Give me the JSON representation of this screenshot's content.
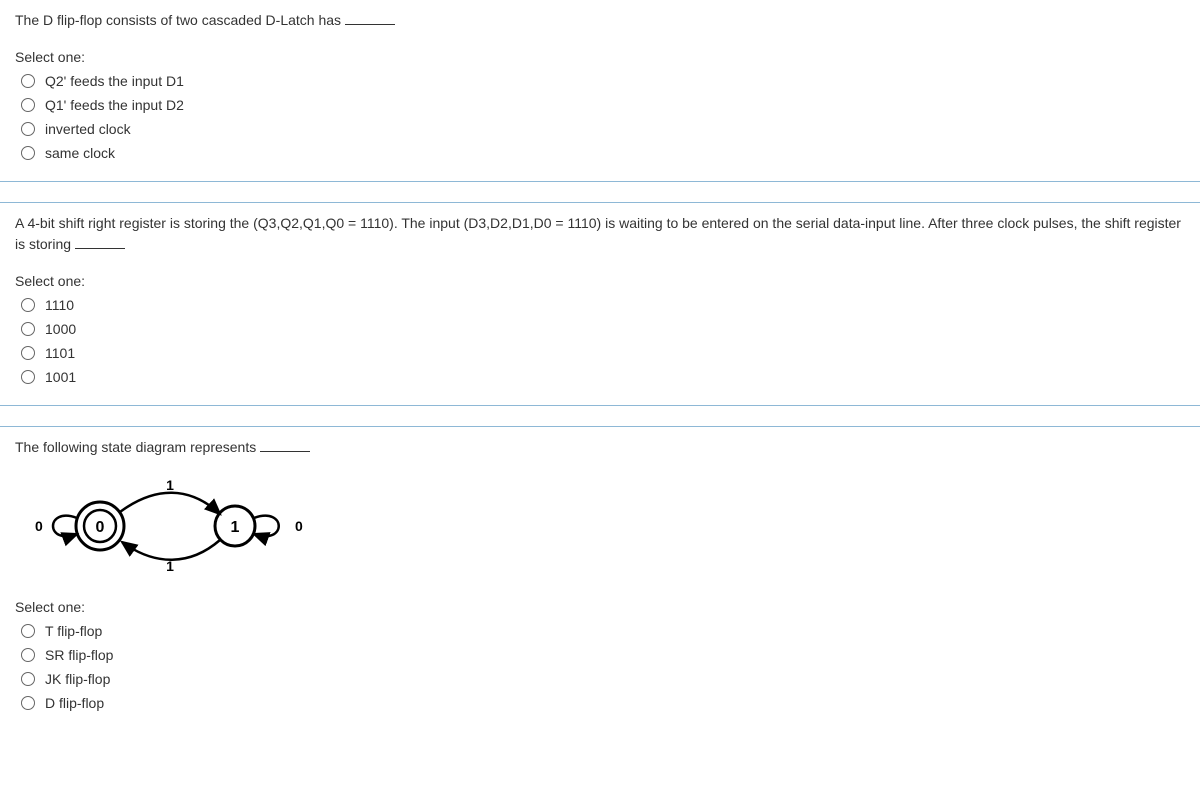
{
  "question1": {
    "text": "The D flip-flop consists of two cascaded D-Latch has",
    "select_label": "Select one:",
    "options": [
      "Q2' feeds the input D1",
      "Q1' feeds the input D2",
      "inverted clock",
      "same clock"
    ]
  },
  "question2": {
    "text": "A 4-bit shift right register is storing the (Q3,Q2,Q1,Q0 = 1110). The input (D3,D2,D1,D0 = 1110) is waiting to be entered on the serial data-input line. After three clock pulses, the shift register is storing",
    "select_label": "Select one:",
    "options": [
      "1110",
      "1000",
      "1101",
      "1001"
    ]
  },
  "question3": {
    "text": "The following state diagram represents",
    "select_label": "Select one:",
    "options": [
      "T flip-flop",
      "SR flip-flop",
      "JK flip-flop",
      "D flip-flop"
    ],
    "diagram": {
      "state0_label": "0",
      "state1_label": "1",
      "self_loop_0": "0",
      "self_loop_1": "0",
      "transition_01": "1",
      "transition_10": "1"
    }
  }
}
